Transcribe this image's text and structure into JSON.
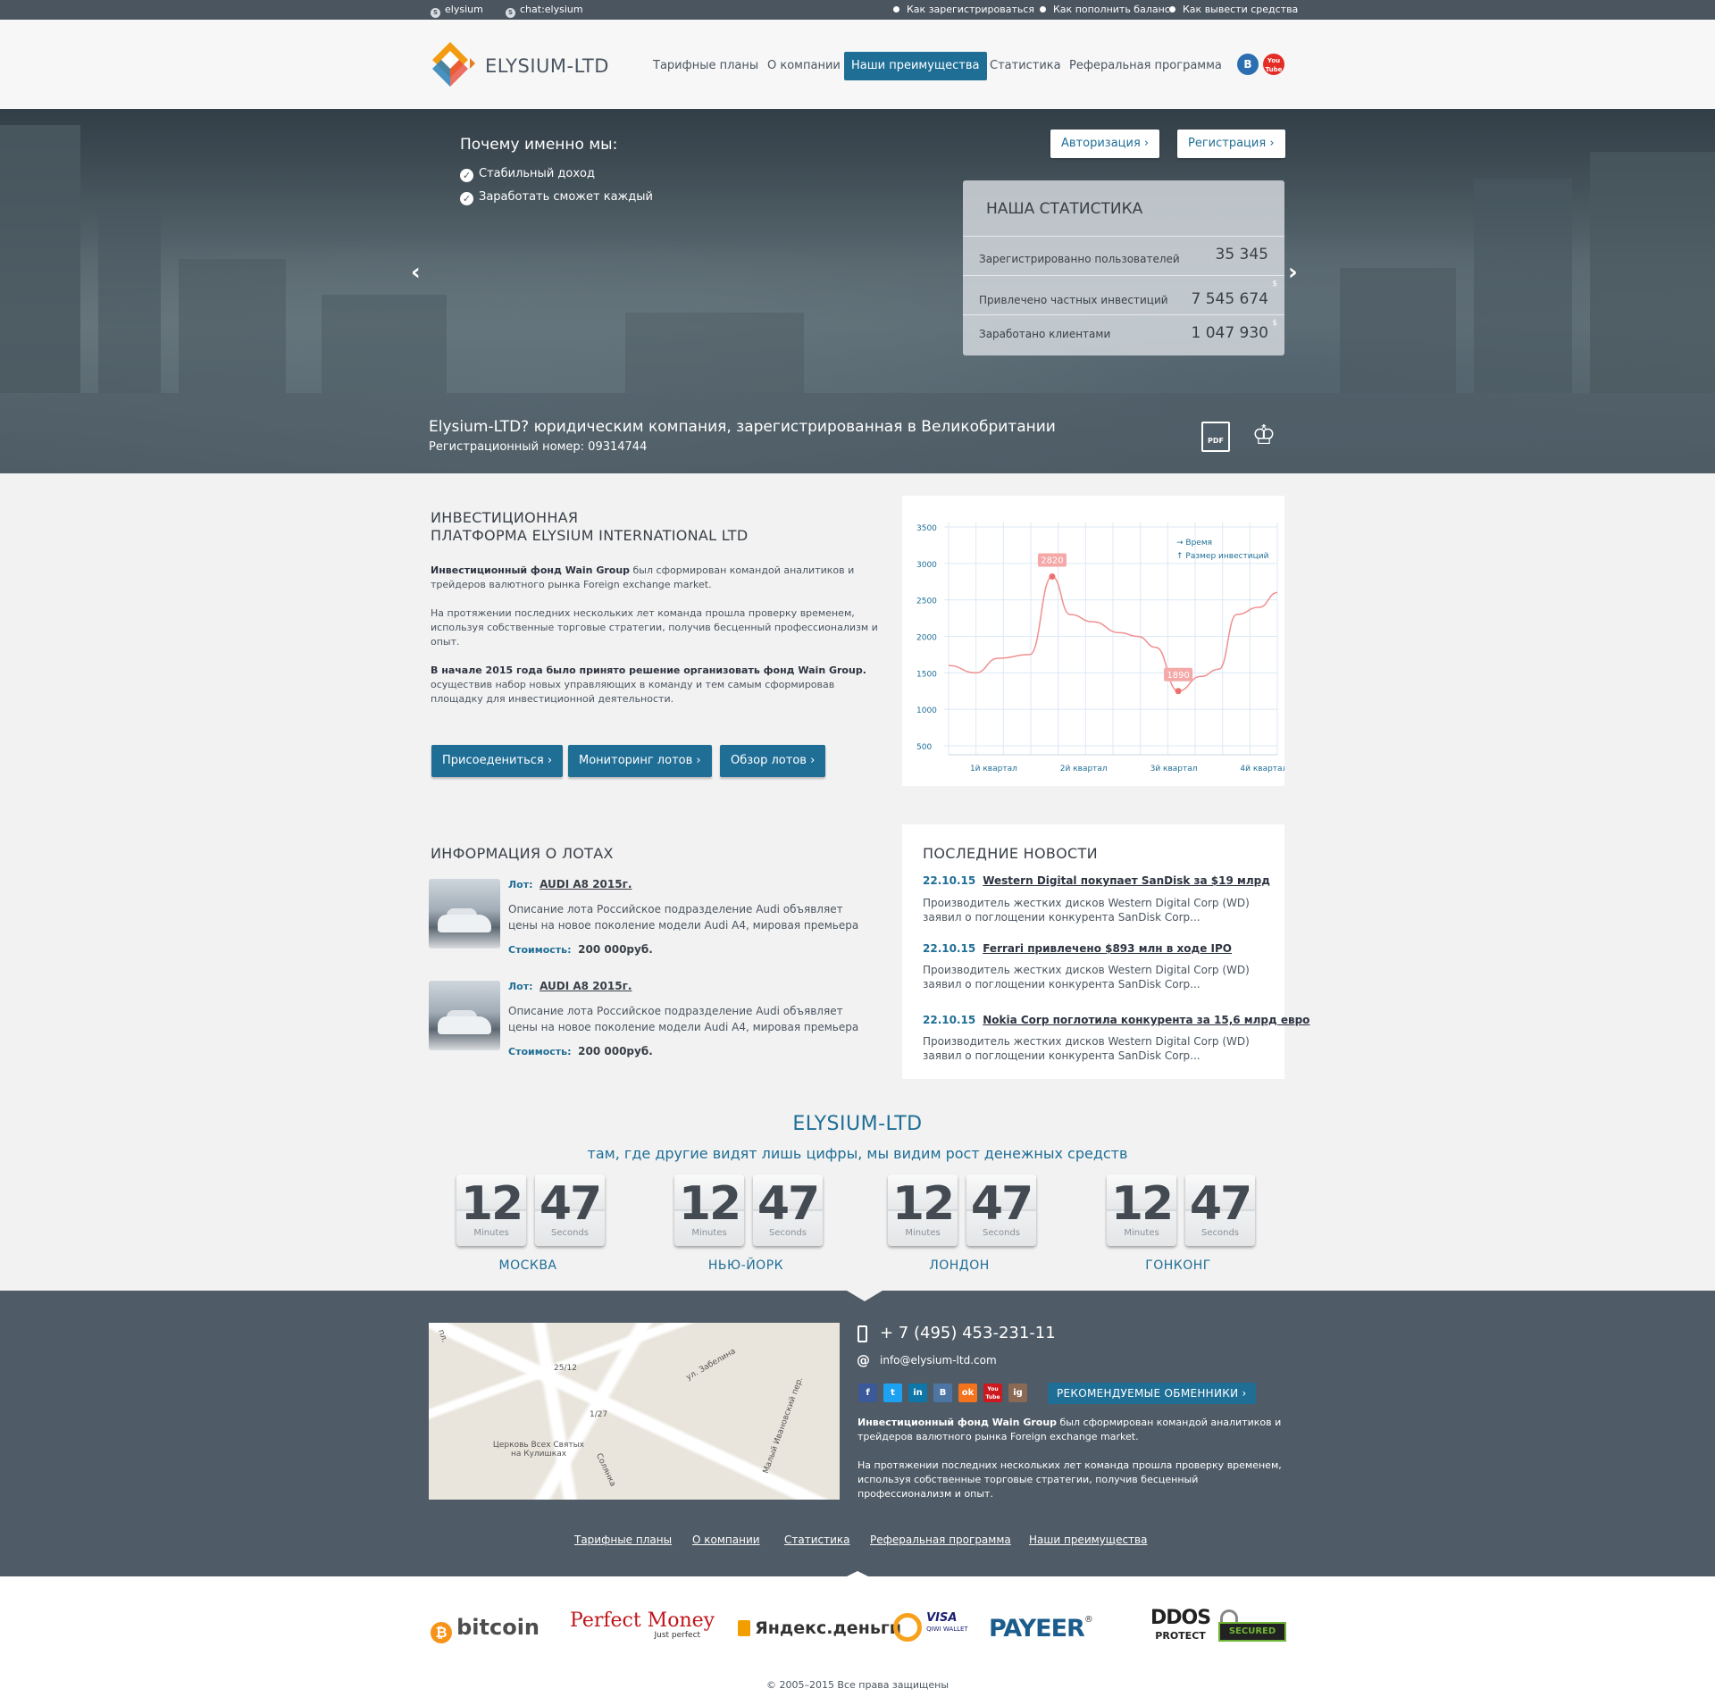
{
  "topbar": {
    "skype1": "elysium",
    "skype2": "chat:elysium",
    "links": [
      "Как зарегистрироваться",
      "Как пополнить баланс",
      "Как вывести средства"
    ]
  },
  "header": {
    "logo_text": "ELYSIUM-LTD",
    "nav": [
      "Тарифные планы",
      "О компании",
      "Наши преимущества",
      "Статистика",
      "Реферальная программа"
    ],
    "active_nav": "Наши преимущества",
    "social": {
      "vk": "B",
      "youtube": "You Tube"
    }
  },
  "hero": {
    "why_title": "Почему именно мы:",
    "why_items": [
      "Стабильный доход",
      "Заработать сможет каждый"
    ],
    "login_button": "Авторизация",
    "register_button": "Регистрация",
    "stats_title": "НАША СТАТИСТИКА",
    "stats": [
      {
        "label": "Зарегистрированно пользователей",
        "value": "35 345",
        "unit": ""
      },
      {
        "label": "Привлечено частных инвестиций",
        "value": "7 545 674",
        "unit": "$"
      },
      {
        "label": "Заработано клиентами",
        "value": "1 047 930",
        "unit": "$"
      }
    ],
    "band_title": "Elysium-LTD? юридическим компания, зарегистрированная в Великобритании",
    "band_sub": "Регистрационный номер: 09314744",
    "pdf_label": "PDF"
  },
  "invest": {
    "title_line1": "ИНВЕСТИЦИОННАЯ",
    "title_line2": "ПЛАТФОРМА ELYSIUM INTERNATIONAL LTD",
    "p1_bold": "Инвестиционный фонд Wain Group",
    "p1_rest": " был сформирован командой аналитиков и трейдеров валютного рынка Foreign exchange market.",
    "p2": "На протяжении последних нескольких лет команда прошла проверку временем, используя собственные торговые стратегии, получив бесценный профессионализм и опыт.",
    "p3_bold": "В начале 2015 года было принято решение организовать фонд Wain Group.",
    "p3_rest": " осуществив набор новых управляющих в команду и тем самым сформировав площадку для инвестиционной деятельности.",
    "buttons": [
      "Присоедениться",
      "Мониторинг лотов",
      "Обзор лотов"
    ]
  },
  "chart_data": {
    "type": "line",
    "categories": [
      "1й квартал",
      "2й квартал",
      "3й квартал",
      "4й квартал"
    ],
    "yticks": [
      500,
      1000,
      1500,
      2000,
      2500,
      3000,
      3500
    ],
    "ylim": [
      500,
      3500
    ],
    "legend": [
      "Время",
      "Размер инвестиций"
    ],
    "legend_position": "top-right",
    "grid": true,
    "color": "#f08f8f",
    "series": [
      {
        "name": "",
        "x": [
          0,
          0.3,
          0.55,
          0.9,
          1.15,
          1.35,
          1.6,
          1.9,
          2.1,
          2.3,
          2.55,
          2.8,
          3.0,
          3.2,
          3.45,
          3.65
        ],
        "values": [
          1600,
          1500,
          1700,
          1750,
          2820,
          2300,
          2200,
          2050,
          2000,
          1850,
          1250,
          1450,
          1550,
          2300,
          2400,
          2600
        ]
      }
    ],
    "annotations": [
      {
        "x": 1.15,
        "y": 2820,
        "label": "2820"
      },
      {
        "x": 2.55,
        "y": 1250,
        "label": "1890"
      }
    ]
  },
  "lots": {
    "title": "ИНФОРМАЦИЯ О ЛОТАХ",
    "lot_key": "Лот:",
    "price_key": "Стоимость:",
    "items": [
      {
        "name": "AUDI A8 2015г.",
        "desc": "Описание лота Российское подразделение Audi объявляет цены на новое поколение модели Audi A4, мировая премьера которого",
        "price": "200 000руб."
      },
      {
        "name": "AUDI A8 2015г.",
        "desc": "Описание лота Российское подразделение Audi объявляет цены на новое поколение модели Audi A4, мировая премьера которого",
        "price": "200 000руб."
      }
    ]
  },
  "news": {
    "title": "ПОСЛЕДНИЕ НОВОСТИ",
    "items": [
      {
        "date": "22.10.15",
        "title": "Western Digital покупает SanDisk за $19 млрд",
        "body": "Производитель жестких дисков Western Digital Corp (WD) заявил о поглощении конкурента SanDisk Corp..."
      },
      {
        "date": "22.10.15",
        "title": "Ferrari привлечено $893 млн в ходе IPO",
        "body": "Производитель жестких дисков Western Digital Corp (WD) заявил о поглощении конкурента SanDisk Corp..."
      },
      {
        "date": "22.10.15",
        "title": "Nokia Corp поглотила конкурента за 15,6 млрд евро",
        "body": "Производитель жестких дисков Western Digital Corp (WD) заявил о поглощении конкурента SanDisk Corp..."
      }
    ]
  },
  "clocks": {
    "title": "ELYSIUM-LTD",
    "subtitle": "там, где другие видят лишь цифры, мы видим рост денежных средств",
    "minutes_label": "Minutes",
    "seconds_label": "Seconds",
    "items": [
      {
        "city": "МОСКВА",
        "minutes": "12",
        "seconds": "47"
      },
      {
        "city": "НЬЮ-ЙОРК",
        "minutes": "12",
        "seconds": "47"
      },
      {
        "city": "ЛОНДОН",
        "minutes": "12",
        "seconds": "47"
      },
      {
        "city": "ГОНКОНГ",
        "minutes": "12",
        "seconds": "47"
      }
    ]
  },
  "footer": {
    "phone": "+ 7 (495) 453-231-11",
    "email": "info@elysium-ltd.com",
    "social": [
      "f",
      "t",
      "in",
      "B",
      "ok",
      "You Tube",
      "ig"
    ],
    "exchangers_button": "РЕКОМЕНДУЕМЫЕ ОБМЕННИКИ",
    "p1_bold": "Инвестиционный фонд Wain Group",
    "p1_rest": " был сформирован командой аналитиков и трейдеров валютного рынка Foreign exchange market.",
    "p2": "На протяжении последних нескольких лет команда прошла проверку временем, используя собственные торговые стратегии, получив бесценный профессионализм и опыт.",
    "map_labels": [
      "ул. Забелина",
      "Малый Ивановский пер.",
      "Церковь Всех Святых на Кулишках",
      "Солянка",
      "пл.",
      "25/12",
      "1/27"
    ],
    "nav": [
      "Тарифные планы",
      "О компании",
      "Статистика",
      "Реферальная программа",
      "Наши преимущества"
    ]
  },
  "payments": {
    "bitcoin": "bitcoin",
    "perfect_money": "Perfect Money",
    "perfect_money_sub": "Just perfect",
    "yandex": "Яндекс.деньги",
    "qiwi": "VISA",
    "qiwi_sub": "QIWI WALLET",
    "payeer": "PAYEER",
    "ddos": "DDOS",
    "ddos_sub": "PROTECT",
    "comodo": "SECURED",
    "copyright": "© 2005–2015 Все права защищены"
  },
  "colors": {
    "accent": "#1f6e96",
    "dark": "#4b5560",
    "chart_line": "#f08f8f"
  }
}
